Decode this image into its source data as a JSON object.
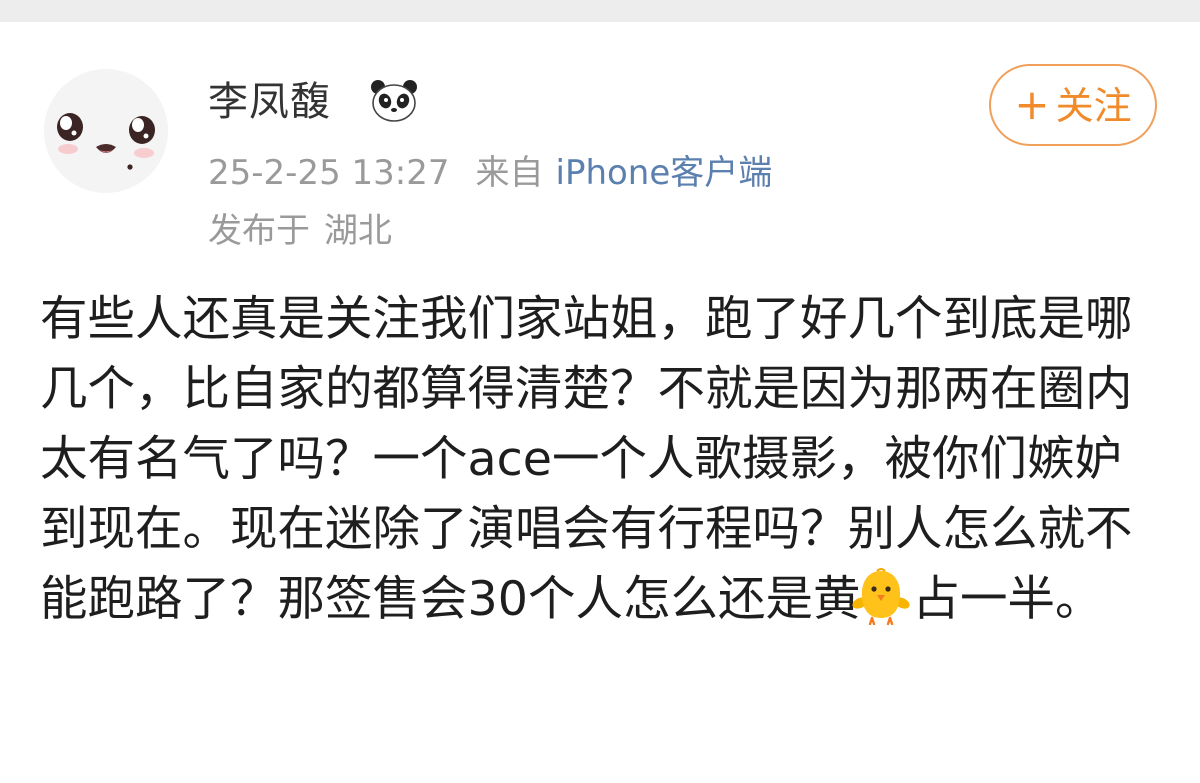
{
  "post": {
    "author": {
      "name": "李凤馥",
      "avatar_icon": "cartoon-face-avatar",
      "badge_icon": "panda-icon"
    },
    "timestamp": "25-2-25 13:27",
    "source_prefix": "来自",
    "source_client": "iPhone客户端",
    "location_prefix": "发布于",
    "location": "湖北",
    "follow_button": {
      "icon": "plus-icon",
      "plus": "+",
      "label": "关注"
    },
    "body_before_emoji": "有些人还真是关注我们家站姐，跑了好几个到底是哪几个，比自家的都算得清楚？不就是因为那两在圈内太有名气了吗？一个ace一个人歌摄影，被你们嫉妒到现在。现在迷除了演唱会有行程吗？别人怎么就不能跑路了？那签售会30个人怎么还是黄",
    "emoji_icon": "chick-emoji-icon",
    "body_after_emoji": "占一半。"
  },
  "colors": {
    "accent_orange": "#f08a2a",
    "link_blue": "#5b7fae",
    "meta_gray": "#9a9a9a",
    "text_dark": "#1e1e1e"
  }
}
